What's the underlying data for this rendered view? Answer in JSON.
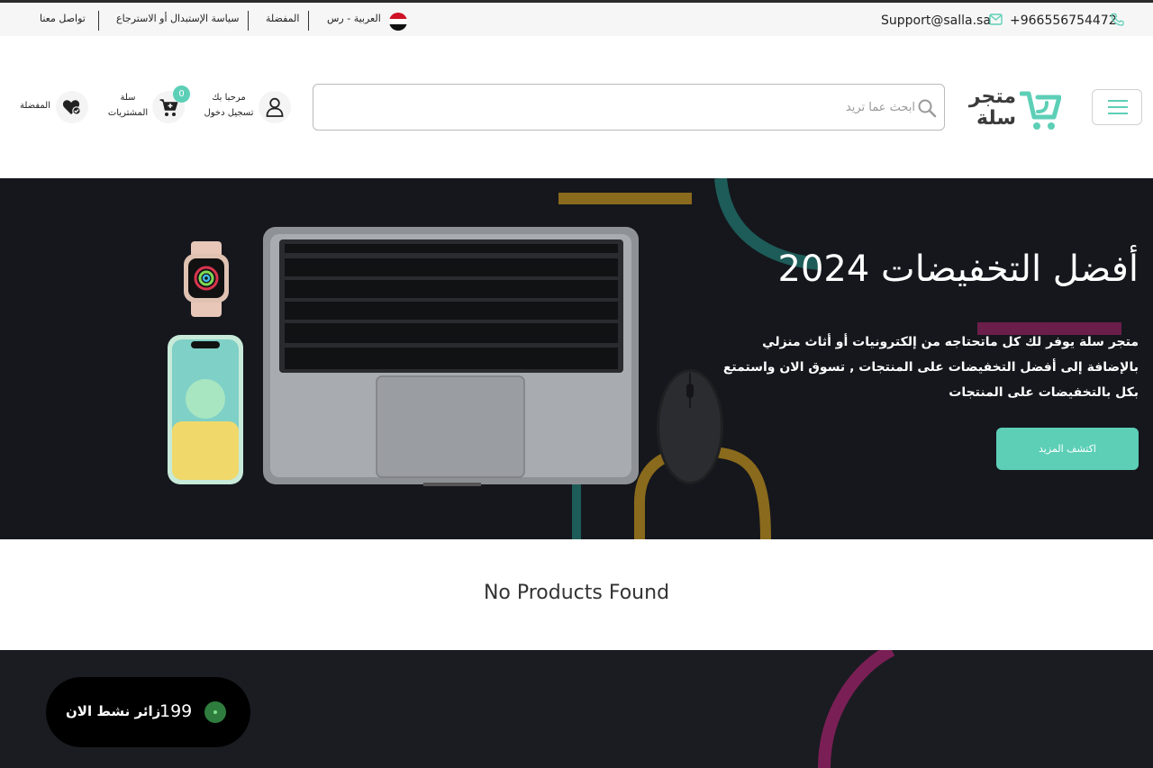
{
  "topbar": {
    "contact_us": "تواصل معنا",
    "return_policy": "سياسة الإستبدال أو الاسترجاع",
    "favorites": "المفضلة",
    "language_currency": "العربية - رس",
    "email": "Support@salla.sa",
    "phone": "+966556754472"
  },
  "header": {
    "logo_line1": "متجر",
    "logo_line2": "سلة",
    "search_placeholder": "ابحث عما تريد",
    "account_greeting": "مرحبا بك",
    "account_login": "تسجيل دخول",
    "cart_line1": "سلة",
    "cart_line2": "المشتريات",
    "cart_count": "0",
    "wishlist_label": "المفضلة"
  },
  "hero": {
    "title": "أفضل التخفيضات 2024",
    "description": "متجر سلة يوفر لك كل ماتحتاجه من إلكترونيات أو أثاث منزلي بالإضافة إلى أفضل التخفيضات على المنتجات , تسوق الان واستمتع بكل بالتخفيضات على المنتجات",
    "cta": "اكتشف المزيد"
  },
  "products": {
    "empty_message": "No Products Found"
  },
  "visitors_widget": {
    "count": "199",
    "label": "زائر نشط الان"
  },
  "colors": {
    "accent": "#5dcfb7",
    "hero_bg": "#15171d",
    "footer_bg": "#1b1c21"
  }
}
